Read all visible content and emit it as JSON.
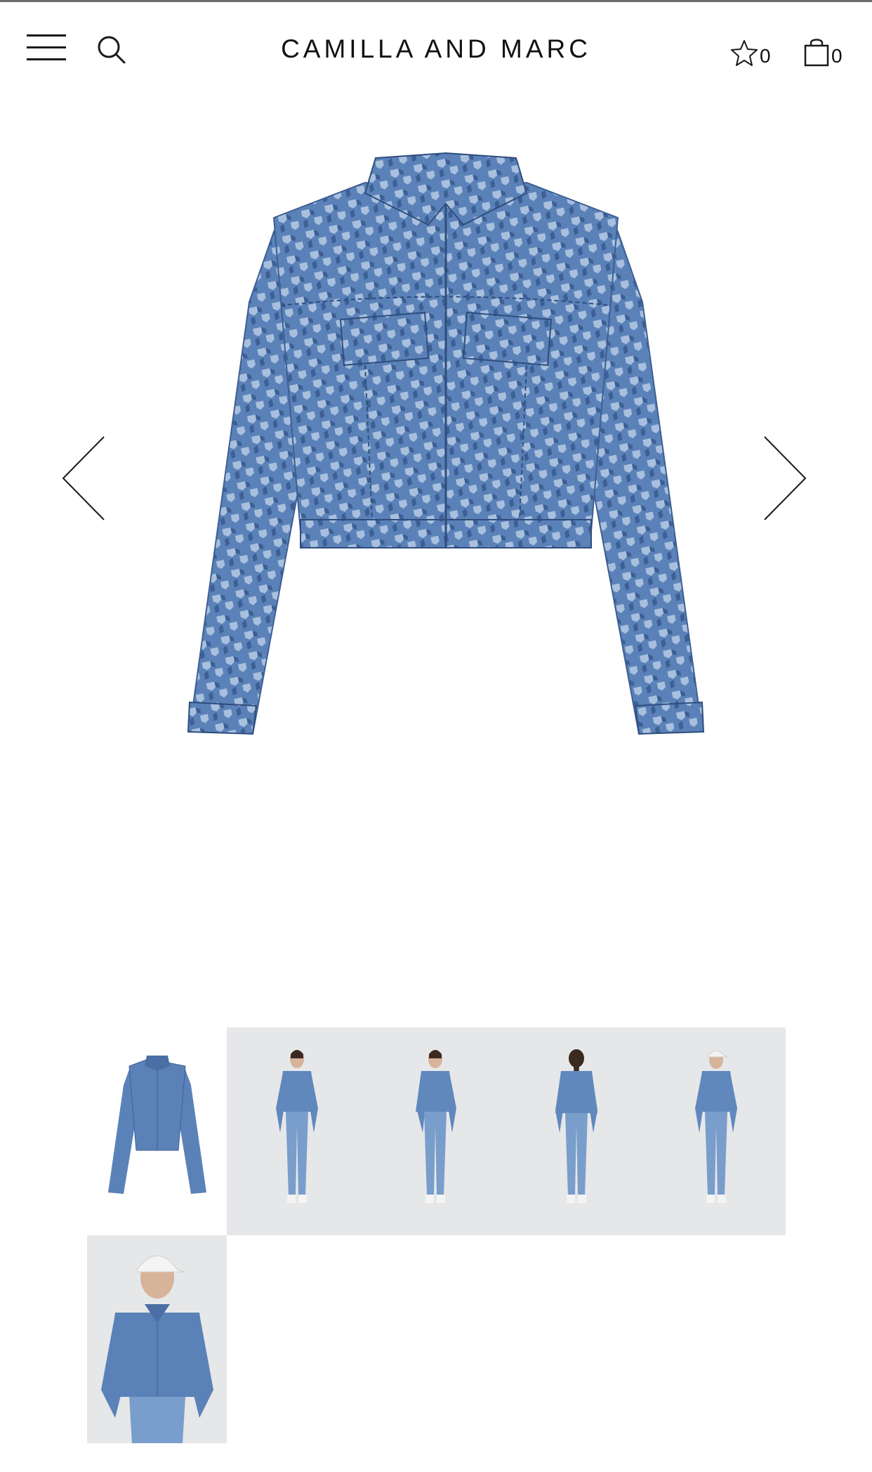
{
  "header": {
    "brand": "CAMILLA AND MARC",
    "wishlist_count": "0",
    "bag_count": "0",
    "icons": [
      "menu-icon",
      "search-icon",
      "star-icon",
      "shopping-bag-icon"
    ]
  },
  "gallery": {
    "main_image": "denim-jacket-product-image",
    "prev_icon": "chevron-left-icon",
    "next_icon": "chevron-right-icon",
    "thumbnails": [
      "jacket-flat-lay",
      "model-front",
      "model-front-alt",
      "model-back",
      "model-front-cap",
      "model-closeup-cap"
    ]
  },
  "colors": {
    "denim": "#5b82b8",
    "denim_dark": "#3c5f95",
    "denim_light": "#a8c0de",
    "thumb_background": "#e6e7e9"
  }
}
